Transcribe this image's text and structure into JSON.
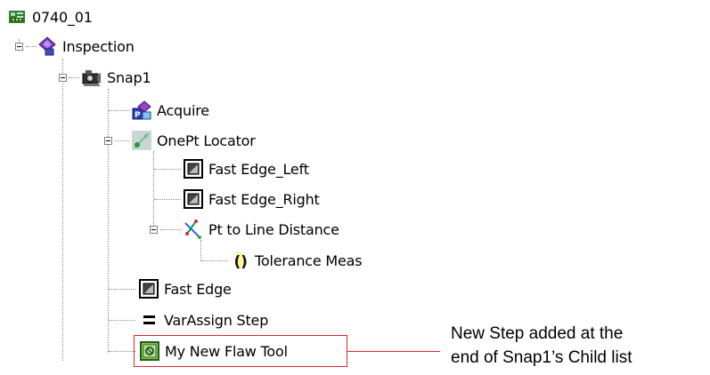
{
  "tree": {
    "root": {
      "label": "0740_01",
      "icon": "circuit-board-icon"
    },
    "nodes": [
      {
        "label": "Inspection",
        "icon": "inspection-icon"
      },
      {
        "label": "Snap1",
        "icon": "camera-icon"
      },
      {
        "label": "Acquire",
        "icon": "acquire-icon"
      },
      {
        "label": "OnePt Locator",
        "icon": "locator-icon"
      },
      {
        "label": "Fast Edge_Left",
        "icon": "edge-tool-icon"
      },
      {
        "label": "Fast Edge_Right",
        "icon": "edge-tool-icon"
      },
      {
        "label": "Pt to Line Distance",
        "icon": "distance-icon"
      },
      {
        "label": "Tolerance Meas",
        "icon": "tolerance-icon"
      },
      {
        "label": "Fast Edge",
        "icon": "edge-tool-icon"
      },
      {
        "label": "VarAssign Step",
        "icon": "equals-icon"
      },
      {
        "label": "My New Flaw Tool",
        "icon": "flaw-tool-icon"
      }
    ]
  },
  "callout": {
    "line1": "New Step added at the",
    "line2": "end of Snap1’s Child list",
    "color": "#e32626"
  }
}
